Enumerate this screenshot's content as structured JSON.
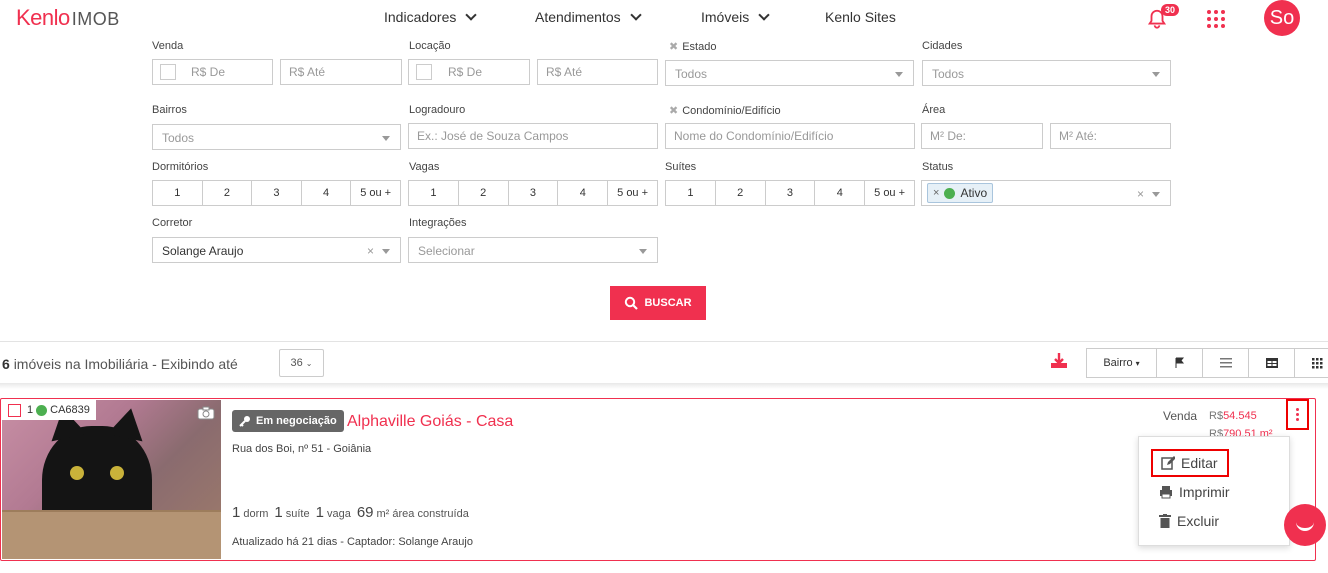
{
  "brand": {
    "logo_main": "Kenlo",
    "logo_sub": "IMOB",
    "accent": "#f0304f"
  },
  "nav": {
    "items": [
      "Indicadores",
      "Atendimentos",
      "Imóveis",
      "Kenlo Sites"
    ],
    "notifications": "30",
    "avatar": "So"
  },
  "filters": {
    "venda": {
      "label": "Venda",
      "de": "R$ De",
      "ate": "R$ Até"
    },
    "locacao": {
      "label": "Locação",
      "de": "R$ De",
      "ate": "R$ Até"
    },
    "estado": {
      "label": "Estado",
      "value": "Todos"
    },
    "cidades": {
      "label": "Cidades",
      "value": "Todos"
    },
    "bairros": {
      "label": "Bairros",
      "value": "Todos"
    },
    "logradouro": {
      "label": "Logradouro",
      "placeholder": "Ex.: José de Souza Campos"
    },
    "condominio": {
      "label": "Condomínio/Edifício",
      "placeholder": "Nome do Condomínio/Edifício"
    },
    "area": {
      "label": "Área",
      "de": "M² De:",
      "ate": "M² Até:"
    },
    "dormitorios": {
      "label": "Dormitórios",
      "options": [
        "1",
        "2",
        "3",
        "4",
        "5 ou +"
      ]
    },
    "vagas": {
      "label": "Vagas",
      "options": [
        "1",
        "2",
        "3",
        "4",
        "5 ou +"
      ]
    },
    "suites": {
      "label": "Suítes",
      "options": [
        "1",
        "2",
        "3",
        "4",
        "5 ou +"
      ]
    },
    "status": {
      "label": "Status",
      "tag": "Ativo",
      "tag_remove": "×",
      "clear": "×"
    },
    "corretor": {
      "label": "Corretor",
      "value": "Solange Araujo",
      "clear": "×"
    },
    "integracoes": {
      "label": "Integrações",
      "value": "Selecionar"
    },
    "buscar": "BUSCAR"
  },
  "results": {
    "count": "6",
    "text": "imóveis na Imobiliária - Exibindo até",
    "per_page": "36",
    "sort": "Bairro"
  },
  "listing": {
    "index": "1",
    "code": "CA6839",
    "badge": "Em negociação",
    "title": "Alphaville Goiás - Casa",
    "address": "Rua dos Boi, nº 51 - Goiânia",
    "specs": [
      {
        "n": "1",
        "label": "dorm"
      },
      {
        "n": "1",
        "label": "suíte"
      },
      {
        "n": "1",
        "label": "vaga"
      },
      {
        "n": "69",
        "label": "m² área construída"
      }
    ],
    "updated": "Atualizado há 21 dias - Captador: Solange Araujo",
    "venda_label": "Venda",
    "price_currency": "R$",
    "price": "54.545",
    "price_m2_currency": "R$",
    "price_m2": "790,51 m²"
  },
  "menu": {
    "edit": "Editar",
    "print": "Imprimir",
    "delete": "Excluir"
  }
}
